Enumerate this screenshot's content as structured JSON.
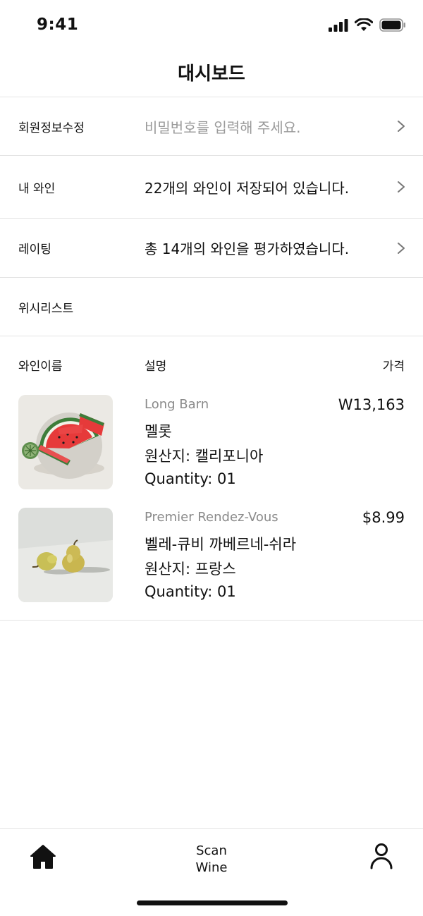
{
  "status_bar": {
    "time": "9:41"
  },
  "header": {
    "title": "대시보드"
  },
  "rows": [
    {
      "label": "회원정보수정",
      "value": "비밀번호를 입력해 주세요."
    },
    {
      "label": "내 와인",
      "value": "22개의 와인이 저장되어 있습니다."
    },
    {
      "label": "레이팅",
      "value": "총 14개의 와인을 평가하였습니다."
    },
    {
      "label": "위시리스트"
    }
  ],
  "wishlist_table": {
    "columns": [
      "와인이름",
      "설명",
      "가격"
    ],
    "items": [
      {
        "brand": "Long Barn",
        "name": "멜롯",
        "origin": "원산지: 캘리포니아",
        "quantity": "Quantity: 01",
        "price": "W13,163",
        "image": "watermelon"
      },
      {
        "brand": "Premier Rendez-Vous",
        "name": "벨레-큐비 까베르네-쉬라",
        "origin": "원산지: 프랑스",
        "quantity": "Quantity: 01",
        "price": "$8.99",
        "image": "pears"
      }
    ]
  },
  "tab_bar": {
    "home_icon": "home-icon",
    "scan_line1": "Scan",
    "scan_line2": "Wine",
    "profile_icon": "profile-icon"
  },
  "colors": {
    "text": "#111111",
    "muted": "#8a8a8a",
    "divider": "#e4e4e4"
  }
}
